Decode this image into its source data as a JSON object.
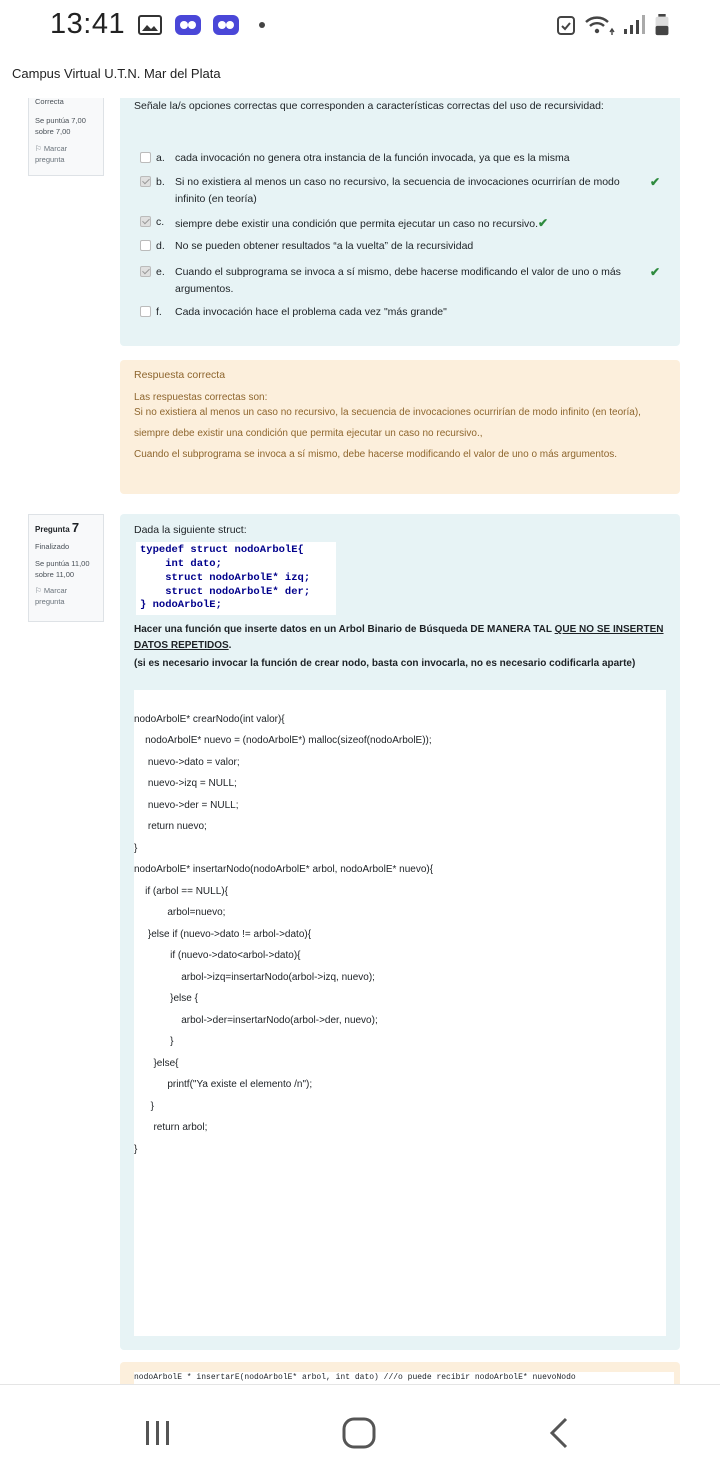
{
  "status": {
    "time": "13:41"
  },
  "app": {
    "title": "Campus Virtual U.T.N. Mar del Plata"
  },
  "q6": {
    "state": "Correcta",
    "grade_line1": "Se puntúa 7,00",
    "grade_line2": "sobre 7,00",
    "flag_line1": "Marcar",
    "flag_line2": "pregunta",
    "prompt": "Señale la/s opciones correctas que corresponden a características correctas del uso de recursividad:",
    "options": [
      {
        "letter": "a.",
        "text": "cada invocación no genera otra instancia de la función invocada, ya que es la misma",
        "checked": false,
        "correct": false
      },
      {
        "letter": "b.",
        "text": "Si no existiera al menos un caso no recursivo, la secuencia de invocaciones ocurrirían de modo infinito (en teoría)",
        "checked": true,
        "correct": true
      },
      {
        "letter": "c.",
        "text": "siempre debe existir una condición que permita ejecutar un caso no recursivo.",
        "checked": true,
        "correct": true
      },
      {
        "letter": "d.",
        "text": "No se pueden obtener resultados “a la vuelta” de la recursividad",
        "checked": false,
        "correct": false
      },
      {
        "letter": "e.",
        "text": "Cuando el subprograma se invoca a sí mismo, debe hacerse modificando el valor de uno o más argumentos.",
        "checked": true,
        "correct": true
      },
      {
        "letter": "f.",
        "text": "Cada invocación hace el problema cada vez \"más grande\"",
        "checked": false,
        "correct": false
      }
    ],
    "feedback": {
      "title": "Respuesta correcta",
      "intro": "Las respuestas correctas son:",
      "answers": [
        "Si no existiera al menos un caso no recursivo, la secuencia de invocaciones ocurrirían de modo infinito (en teoría),",
        "siempre debe existir una condición que permita ejecutar un caso no recursivo.,",
        "Cuando el subprograma se invoca a sí mismo, debe hacerse modificando el valor de uno o más argumentos."
      ]
    }
  },
  "q7": {
    "label": "Pregunta",
    "number": "7",
    "state": "Finalizado",
    "grade_line1": "Se puntúa 11,00",
    "grade_line2": "sobre 11,00",
    "flag_line1": "Marcar",
    "flag_line2": "pregunta",
    "intro": "Dada la siguiente struct:",
    "struct_code": [
      "typedef struct nodoArbolE{",
      "    int dato;",
      "    struct nodoArbolE* izq;",
      "    struct nodoArbolE* der;",
      "} nodoArbolE;"
    ],
    "instruction_a": "Hacer una función que inserte datos en un Arbol Binario de Búsqueda DE MANERA TAL ",
    "instruction_u": "QUE NO SE INSERTEN DATOS REPETIDOS",
    "instruction_end": ".",
    "note": "(si es necesario invocar la función de crear nodo, basta con invocarla, no es necesario codificarla aparte)",
    "answer_lines": [
      "nodoArbolE* crearNodo(int valor){",
      "    nodoArbolE* nuevo = (nodoArbolE*) malloc(sizeof(nodoArbolE));",
      "     nuevo->dato = valor;",
      "     nuevo->izq = NULL;",
      "     nuevo->der = NULL;",
      "     return nuevo;",
      "}",
      "nodoArbolE* insertarNodo(nodoArbolE* arbol, nodoArbolE* nuevo){",
      "    if (arbol == NULL){",
      "            arbol=nuevo;",
      "     }else if (nuevo->dato != arbol->dato){",
      "             if (nuevo->dato<arbol->dato){",
      "                 arbol->izq=insertarNodo(arbol->izq, nuevo);",
      "             }else {",
      "                 arbol->der=insertarNodo(arbol->der, nuevo);",
      "             }",
      "       }else{",
      "            printf(\"Ya existe el elemento /n\");",
      "      }",
      "       return arbol;",
      "}"
    ]
  },
  "feedback7_code": "nodoArbolE * insertarE(nodoArbolE* arbol, int dato) ///o puede recibir nodoArbolE* nuevoNodo"
}
